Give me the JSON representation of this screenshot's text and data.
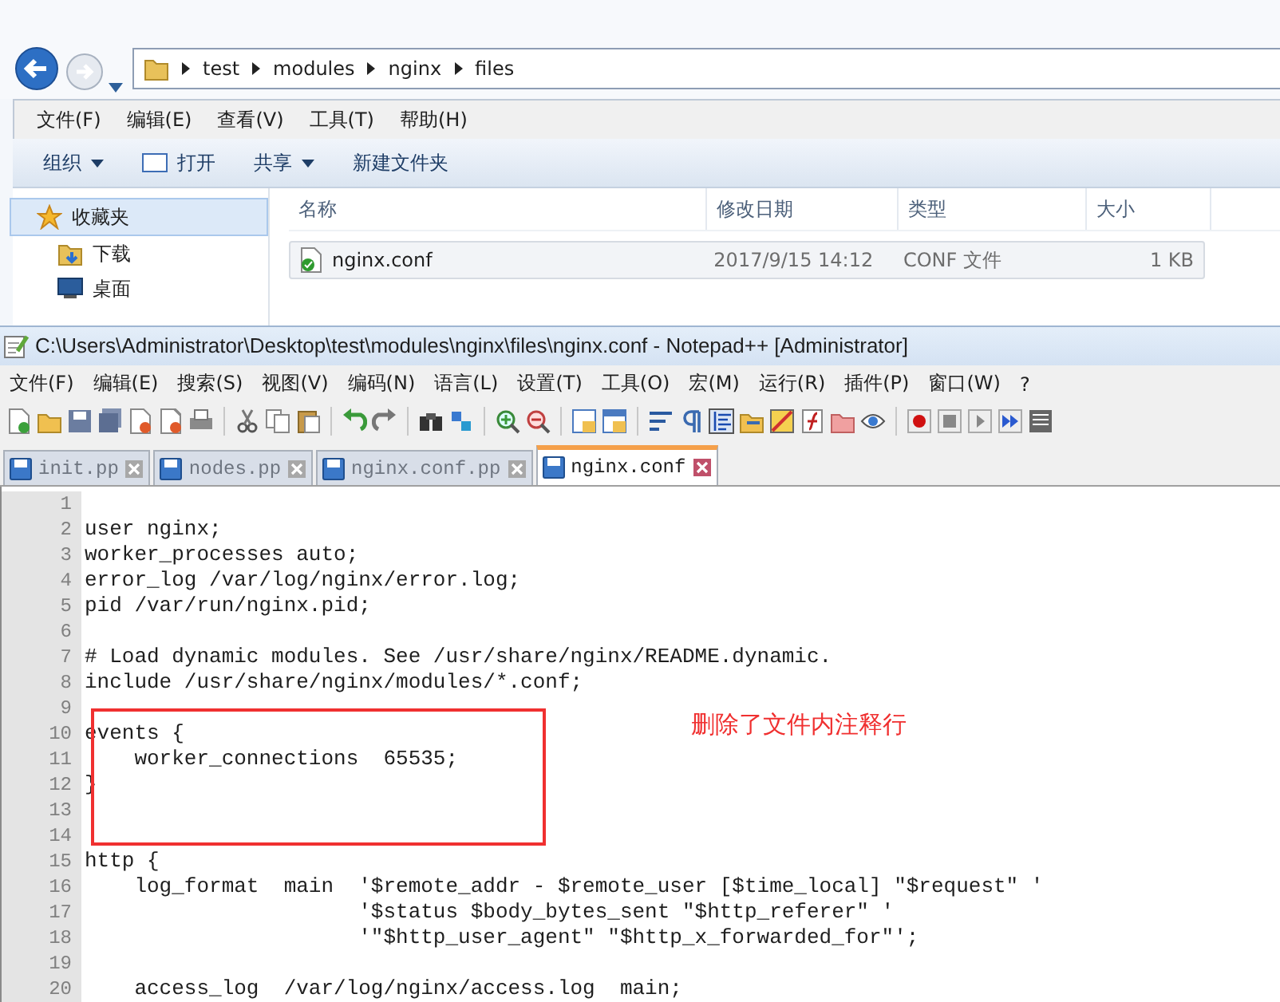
{
  "explorer": {
    "breadcrumb": [
      "test",
      "modules",
      "nginx",
      "files"
    ],
    "menu": [
      "文件(F)",
      "编辑(E)",
      "查看(V)",
      "工具(T)",
      "帮助(H)"
    ],
    "commands": [
      {
        "label": "组织",
        "dropdown": true,
        "kind": "plain"
      },
      {
        "label": "打开",
        "dropdown": false,
        "kind": "open"
      },
      {
        "label": "共享",
        "dropdown": true,
        "kind": "plain"
      },
      {
        "label": "新建文件夹",
        "dropdown": false,
        "kind": "plain"
      }
    ],
    "nav": [
      {
        "label": "收藏夹",
        "kind": "star",
        "selected": true
      },
      {
        "label": "下载",
        "kind": "download",
        "selected": false
      },
      {
        "label": "桌面",
        "kind": "desktop",
        "selected": false
      }
    ],
    "columns": [
      "名称",
      "修改日期",
      "类型",
      "大小"
    ],
    "files": [
      {
        "name": "nginx.conf",
        "modified": "2017/9/15 14:12",
        "type": "CONF 文件",
        "size": "1 KB",
        "selected": true
      }
    ]
  },
  "editor": {
    "title": "C:\\Users\\Administrator\\Desktop\\test\\modules\\nginx\\files\\nginx.conf - Notepad++ [Administrator]",
    "menu": [
      "文件(F)",
      "编辑(E)",
      "搜索(S)",
      "视图(V)",
      "编码(N)",
      "语言(L)",
      "设置(T)",
      "工具(O)",
      "宏(M)",
      "运行(R)",
      "插件(P)",
      "窗口(W)",
      "?"
    ],
    "tabs": [
      {
        "label": "init.pp",
        "selected": false
      },
      {
        "label": "nodes.pp",
        "selected": false
      },
      {
        "label": "nginx.conf.pp",
        "selected": false
      },
      {
        "label": "nginx.conf",
        "selected": true
      }
    ],
    "lines": [
      {
        "number": "1"
      },
      {
        "number": "2",
        "text": "user nginx;"
      },
      {
        "number": "3",
        "text": "worker_processes auto;"
      },
      {
        "number": "4",
        "text": "error_log /var/log/nginx/error.log;"
      },
      {
        "number": "5",
        "text": "pid /var/run/nginx.pid;"
      },
      {
        "number": "6"
      },
      {
        "number": "7",
        "text": "# Load dynamic modules. See /usr/share/nginx/README.dynamic."
      },
      {
        "number": "8",
        "text": "include /usr/share/nginx/modules/*.conf;"
      },
      {
        "number": "9"
      },
      {
        "number": "10",
        "text": "events {"
      },
      {
        "number": "11",
        "text": "    worker_connections  65535;"
      },
      {
        "number": "12",
        "text": "}"
      },
      {
        "number": "13"
      },
      {
        "number": "14"
      },
      {
        "number": "15",
        "text": "http {"
      },
      {
        "number": "16",
        "text": "    log_format  main  '$remote_addr - $remote_user [$time_local] \"$request\" '"
      },
      {
        "number": "17",
        "text": "                      '$status $body_bytes_sent \"$http_referer\" '"
      },
      {
        "number": "18",
        "text": "                      '\"$http_user_agent\" \"$http_x_forwarded_for\"';"
      },
      {
        "number": "19"
      },
      {
        "number": "20",
        "text": "    access_log  /var/log/nginx/access.log  main;"
      }
    ]
  },
  "annotation": {
    "note": "删除了文件内注释行"
  }
}
